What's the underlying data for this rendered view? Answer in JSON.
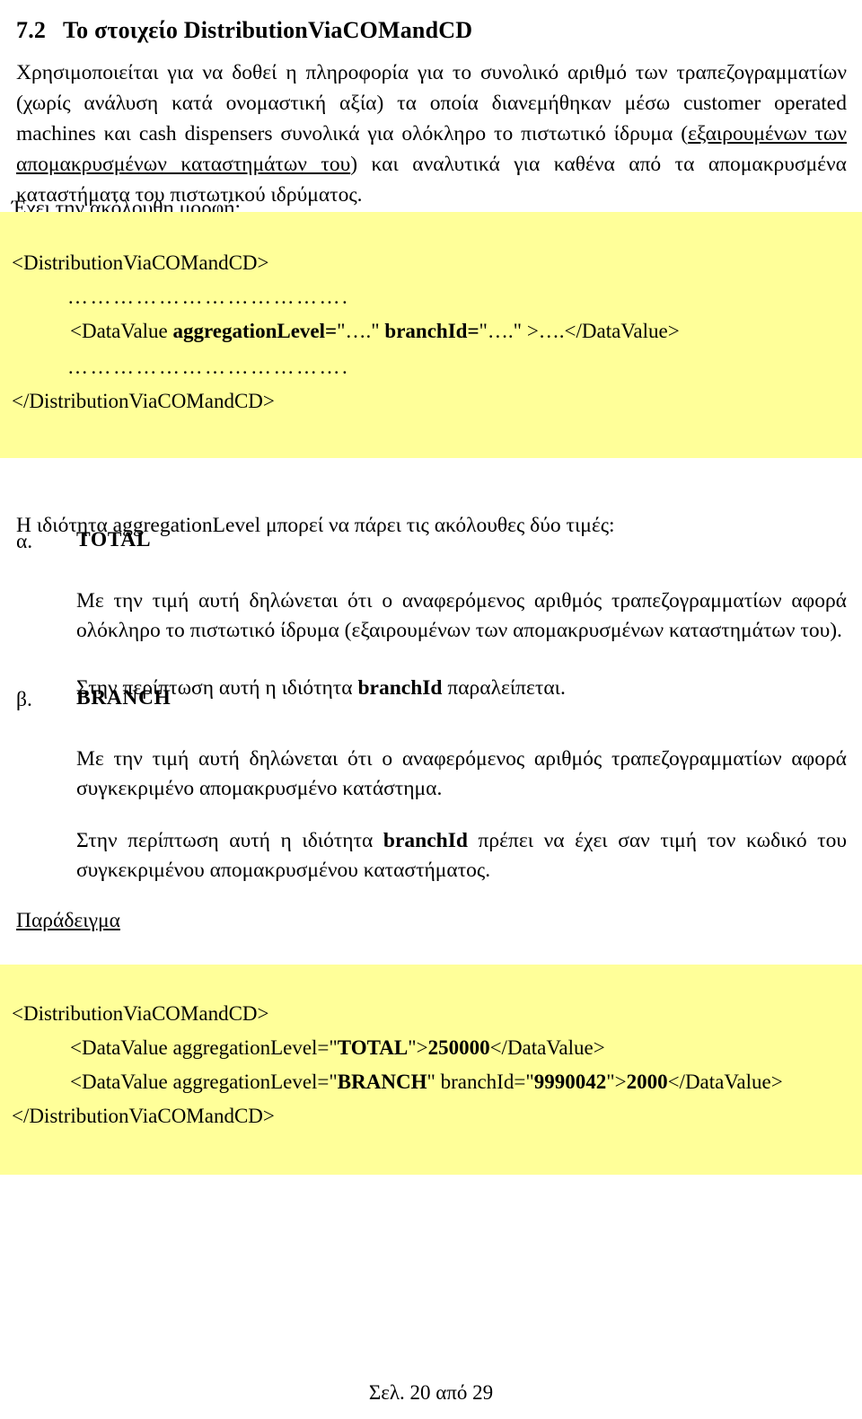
{
  "document": {
    "heading": {
      "number": "7.2",
      "text": "Το στοιχείο DistributionViaCOMandCD"
    },
    "intro": {
      "part1": "Χρησιμοποιείται για να δοθεί η πληροφορία για το συνολικό αριθμό των τραπεζογραμματίων (χωρίς ανάλυση κατά ονομαστική αξία) τα οποία διανεμήθηκαν μέσω customer operated machines και cash dispensers συνολικά για ολόκληρο το πιστωτικό ίδρυμα (",
      "underlined": "εξαιρουμένων των απομακρυσμένων καταστημάτων του",
      "part2": ") και αναλυτικά για καθένα από τα απομακρυσμένα καταστήματα του πιστωτικού ιδρύματος."
    },
    "form_lead": "Έχει την ακόλουθη μορφή:",
    "syntax_block": {
      "open_tag": "<DistributionViaCOMandCD>",
      "dots_upper": "……………………………….",
      "datavalue": {
        "prefix": "<DataValue ",
        "attr1_name": "aggregationLevel=",
        "attr1_value": "\"….\"",
        "gap": "  ",
        "attr2_name": "branchId=",
        "attr2_value": "\"….\"",
        "suffix": " >….</DataValue>"
      },
      "dots_lower": "……………………………….",
      "close_tag": "</DistributionViaCOMandCD>"
    },
    "values_lead": "Η ιδιότητα aggregationLevel μπορεί να πάρει τις ακόλουθες δύο τιμές:",
    "values": [
      {
        "marker": "α.",
        "name": "TOTAL",
        "body": "Με την τιμή αυτή δηλώνεται ότι ο αναφερόμενος αριθμός τραπεζογραμματίων αφορά ολόκληρο το πιστωτικό ίδρυμα (εξαιρουμένων των απομακρυσμένων καταστημάτων του).",
        "note_prefix": "Στην περίπτωση αυτή η ιδιότητα ",
        "note_bold": "branchId",
        "note_suffix": " παραλείπεται."
      },
      {
        "marker": "β.",
        "name": "BRANCH",
        "body": "Με την τιμή αυτή δηλώνεται ότι ο αναφερόμενος αριθμός τραπεζογραμματίων αφορά συγκεκριμένο απομακρυσμένο κατάστημα.",
        "note_prefix": "Στην περίπτωση αυτή η ιδιότητα ",
        "note_bold": "branchId",
        "note_suffix": " πρέπει να έχει σαν τιμή τον κωδικό του συγκεκριμένου απομακρυσμένου καταστήματος."
      }
    ],
    "example_label": "Παράδειγμα",
    "example_block": {
      "open_tag": "<DistributionViaCOMandCD>",
      "line_total": {
        "prefix": "<DataValue aggregationLevel=\"",
        "level": "TOTAL",
        "mid": "\">",
        "value": "250000",
        "suffix": "</DataValue>"
      },
      "line_branch": {
        "prefix": "<DataValue aggregationLevel=\"",
        "level": "BRANCH",
        "mid": "\" branchId=\"",
        "branch_id": "9990042",
        "mid2": "\">",
        "value": "2000",
        "suffix": "</DataValue>"
      },
      "close_tag": "</DistributionViaCOMandCD>"
    },
    "footer": "Σελ. 20 από 29",
    "colors": {
      "code_highlight": "#FFFF99",
      "text": "#000000",
      "page_background": "#FFFFFF"
    }
  }
}
